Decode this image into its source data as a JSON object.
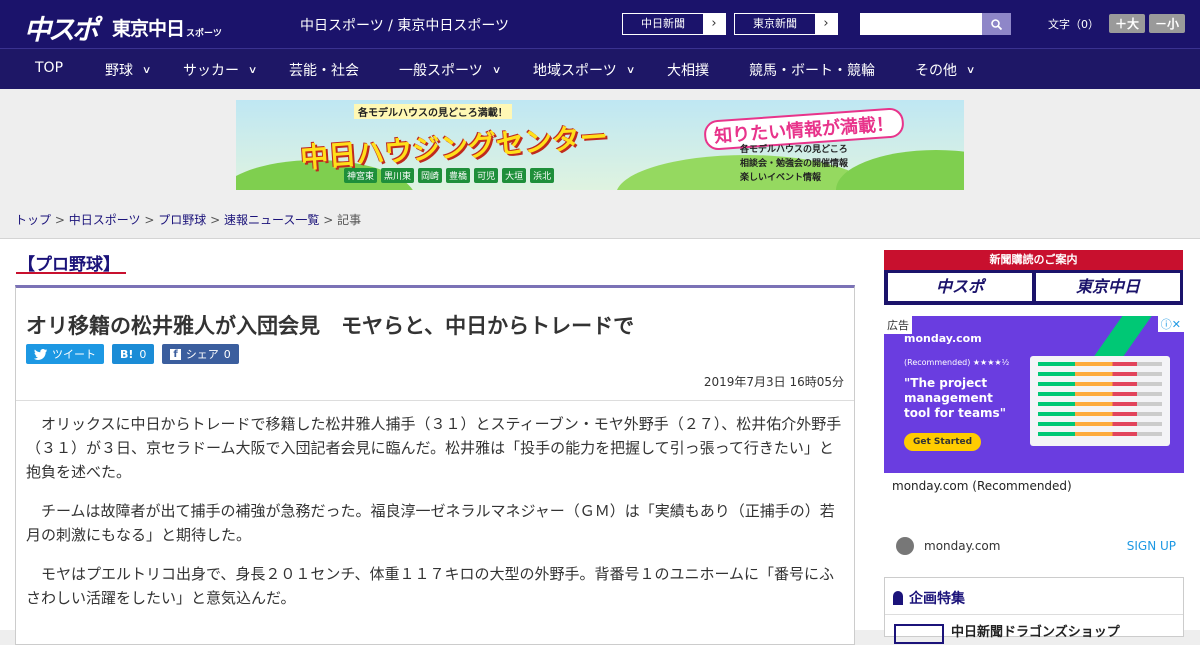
{
  "header": {
    "logo_main": "中スポ",
    "logo_tokyo": "東京中日",
    "logo_suffix": "スポーツ",
    "site_name": "中日スポーツ / 東京中日スポーツ",
    "links": [
      {
        "label": "中日新聞",
        "arrow": "›"
      },
      {
        "label": "東京新聞",
        "arrow": "›"
      }
    ],
    "search_placeholder": "",
    "font_size_label": "文字（0）",
    "font_larger": "＋大",
    "font_smaller": "－小"
  },
  "nav": {
    "items": [
      {
        "label": "TOP"
      },
      {
        "label": "野球",
        "chevron": "∨"
      },
      {
        "label": "サッカー",
        "chevron": "∨"
      },
      {
        "label": "芸能・社会"
      },
      {
        "label": "一般スポーツ",
        "chevron": "∨"
      },
      {
        "label": "地域スポーツ",
        "chevron": "∨"
      },
      {
        "label": "大相撲"
      },
      {
        "label": "競馬・ボート・競輪"
      },
      {
        "label": "その他",
        "chevron": "∨"
      }
    ]
  },
  "banner": {
    "kicker": "各モデルハウスの見どころ満載！",
    "title": "中日ハウジングセンター",
    "tagline": "知りたい情報が満載！",
    "features": [
      "各モデルハウスの見どころ",
      "相談会・勉強会の開催情報",
      "楽しいイベント情報"
    ],
    "places": [
      "神宮東",
      "黒川東",
      "岡崎",
      "豊橋",
      "可児",
      "大垣",
      "浜北"
    ]
  },
  "breadcrumb": {
    "items": [
      "トップ",
      "中日スポーツ",
      "プロ野球",
      "速報ニュース一覧"
    ],
    "separator": ">",
    "current": "記事"
  },
  "article": {
    "category": "【プロ野球】",
    "headline": "オリ移籍の松井雅人が入団会見　モヤらと、中日からトレードで",
    "social": {
      "tweet": "ツイート",
      "hatena_icon": "B!",
      "hatena_count": "0",
      "facebook_icon": "f",
      "share": "シェア",
      "share_count": "0"
    },
    "date": "2019年7月3日 16時05分",
    "paragraphs": [
      "オリックスに中日からトレードで移籍した松井雅人捕手（３１）とスティーブン・モヤ外野手（２７）、松井佑介外野手（３１）が３日、京セラドーム大阪で入団記者会見に臨んだ。松井雅は「投手の能力を把握して引っ張って行きたい」と抱負を述べた。",
      "チームは故障者が出て捕手の補強が急務だった。福良淳一ゼネラルマネジャー（ＧＭ）は「実績もあり（正捕手の）若月の刺激にもなる」と期待した。",
      "モヤはプエルトリコ出身で、身長２０１センチ、体重１１７キロの大型の外野手。背番号１のユニホームに「番号にふさわしい活躍をしたい」と意気込んだ。"
    ]
  },
  "sidebar": {
    "subscription": {
      "header": "新聞購読のご案内",
      "logo_left": "中スポ",
      "logo_right": "東京中日"
    },
    "ad": {
      "label": "広告",
      "close": "ⓘ✕",
      "brand": "monday.com",
      "rec": "(Recommended) ★★★★½",
      "promo": "\"The project management tool for teams\"",
      "cta": "Get Started",
      "title": "monday.com (Recommended)",
      "footer_name": "monday.com",
      "signup": "SIGN UP"
    },
    "special": {
      "header": "企画特集",
      "item": "中日新聞ドラゴンズショップ"
    }
  },
  "colors": {
    "header_bg": "#1b136b",
    "accent_red": "#c8102e",
    "accent_purple": "#7b72b6",
    "twitter": "#1d98e3",
    "facebook": "#3b5e9e"
  }
}
